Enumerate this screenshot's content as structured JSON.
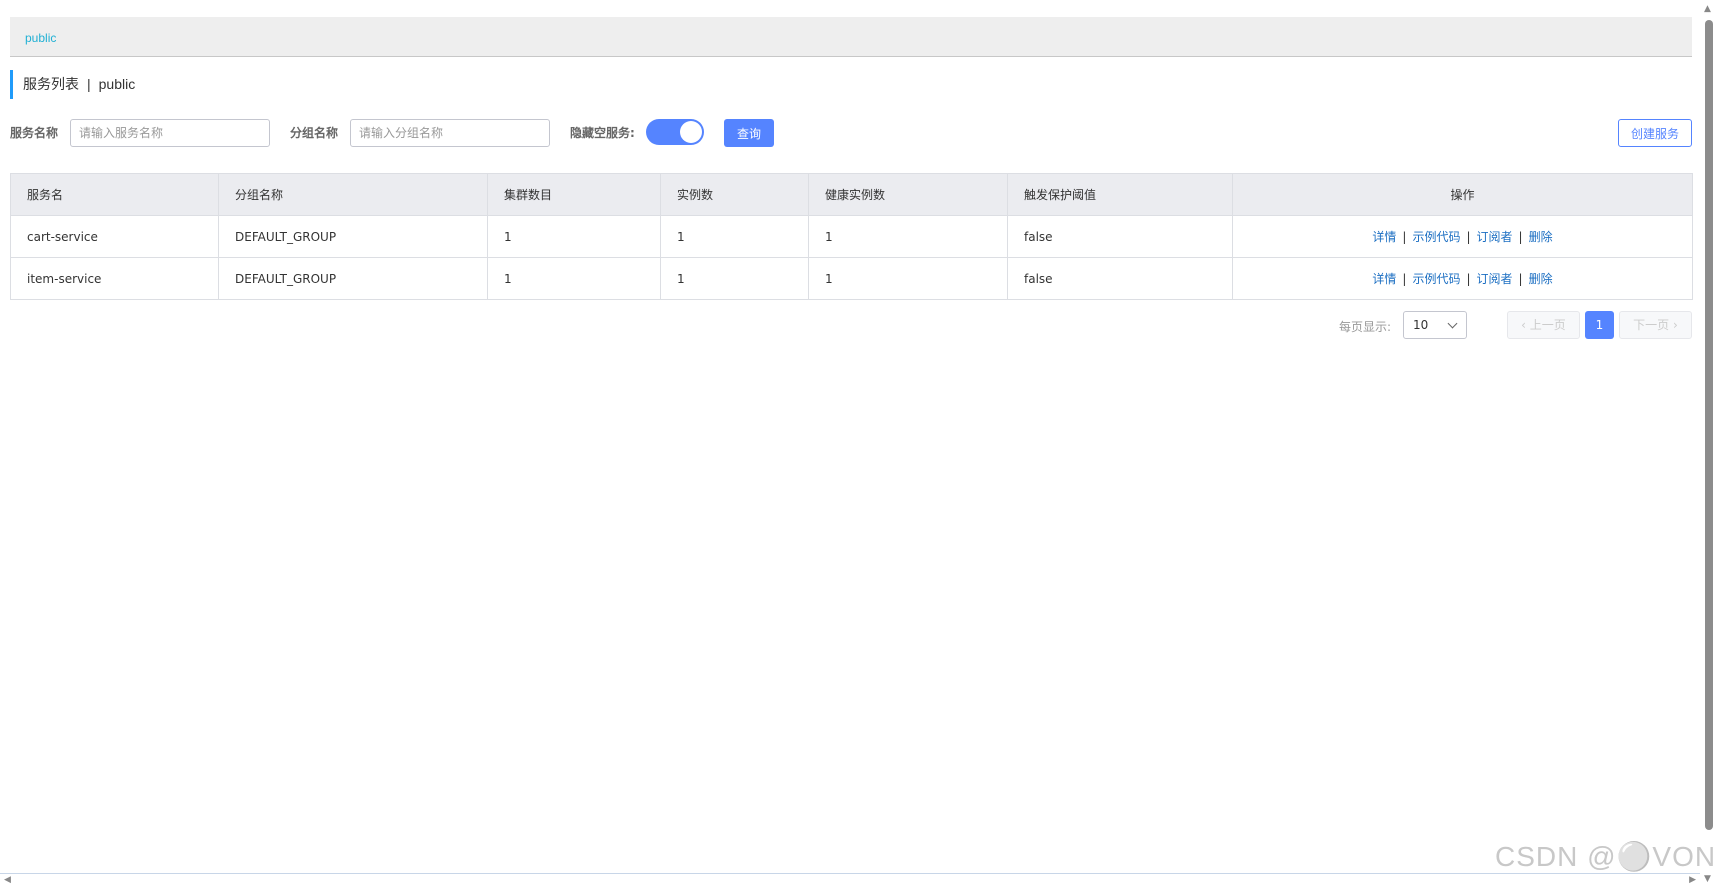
{
  "namespace": {
    "active": "public"
  },
  "title": {
    "main": "服务列表",
    "separator": "|",
    "namespace": "public"
  },
  "filters": {
    "service_label": "服务名称",
    "service_placeholder": "请输入服务名称",
    "group_label": "分组名称",
    "group_placeholder": "请输入分组名称",
    "hide_empty_label": "隐藏空服务:",
    "hide_empty_on": true,
    "query_button": "查询",
    "create_button": "创建服务"
  },
  "table": {
    "columns": [
      "服务名",
      "分组名称",
      "集群数目",
      "实例数",
      "健康实例数",
      "触发保护阈值",
      "操作"
    ],
    "rows": [
      {
        "name": "cart-service",
        "group": "DEFAULT_GROUP",
        "clusters": "1",
        "instances": "1",
        "healthy": "1",
        "threshold": "false"
      },
      {
        "name": "item-service",
        "group": "DEFAULT_GROUP",
        "clusters": "1",
        "instances": "1",
        "healthy": "1",
        "threshold": "false"
      }
    ],
    "ops": {
      "detail": "详情",
      "sample": "示例代码",
      "subscribers": "订阅者",
      "delete": "删除",
      "sep": "|"
    }
  },
  "pagination": {
    "page_size_label": "每页显示:",
    "page_size": "10",
    "prev": "上一页",
    "next": "下一页",
    "current": "1"
  },
  "watermark": "CSDN @⚪VON",
  "colors": {
    "primary": "#5584ff",
    "link": "#1b6ec2",
    "namespace": "#20b0d4",
    "title_bar": "#209bfa"
  }
}
